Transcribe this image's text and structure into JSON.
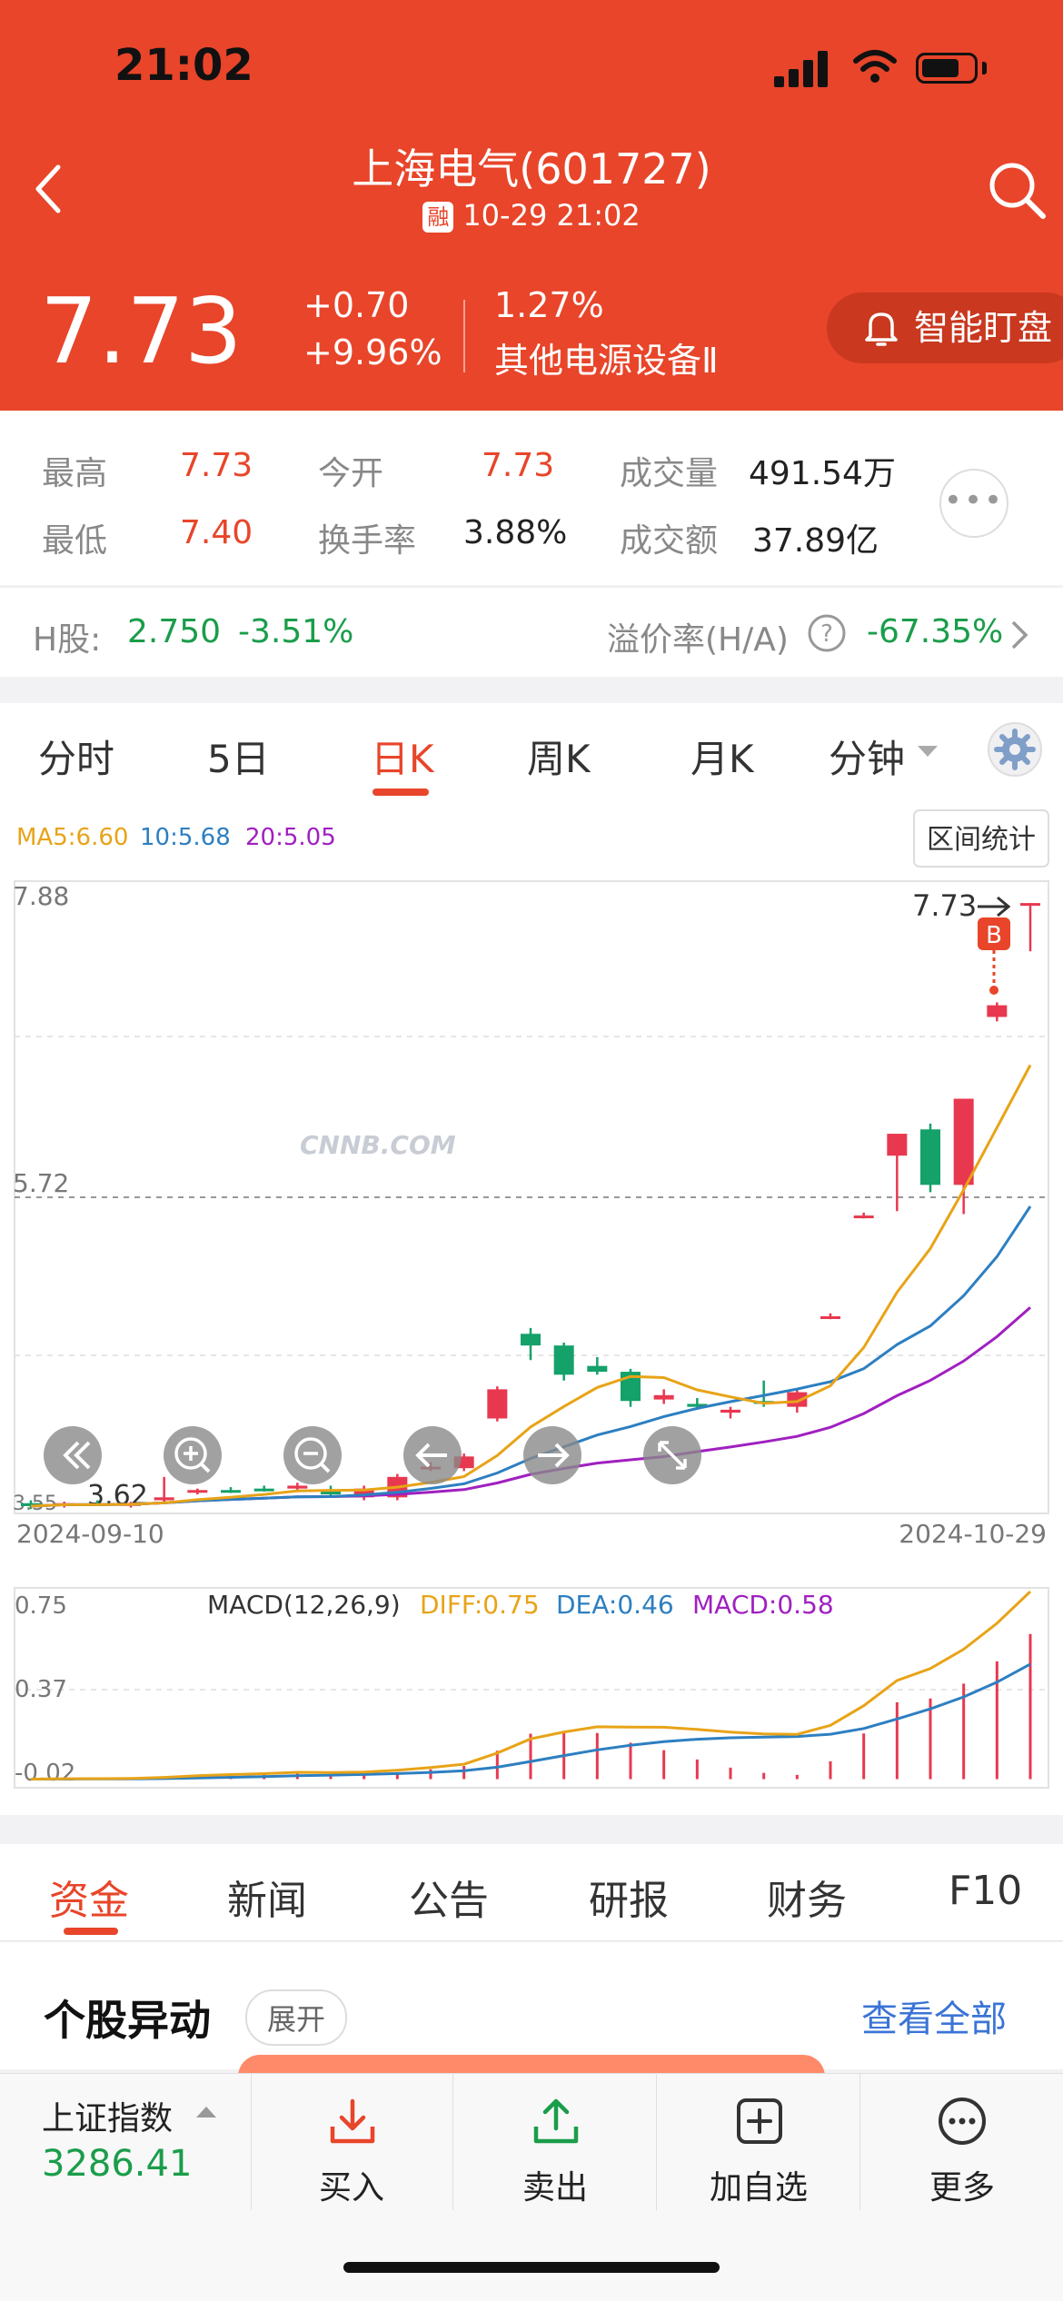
{
  "status_bar": {
    "time": "21:02"
  },
  "header": {
    "title": "上海电气(601727)",
    "rong_badge": "融",
    "datetime": "10-29 21:02",
    "price": "7.73",
    "change": "+0.70",
    "change_pct": "+9.96%",
    "industry_pct": "1.27%",
    "industry": "其他电源设备Ⅱ",
    "watch_label": "智能盯盘"
  },
  "quote": {
    "high_label": "最高",
    "high": "7.73",
    "open_label": "今开",
    "open": "7.73",
    "volume_label": "成交量",
    "volume": "491.54万",
    "low_label": "最低",
    "low": "7.40",
    "turnover_label": "换手率",
    "turnover": "3.88%",
    "amount_label": "成交额",
    "amount": "37.89亿"
  },
  "hshare": {
    "label": "H股:",
    "price": "2.750",
    "change_pct": "-3.51%",
    "premium_label": "溢价率(H/A)",
    "premium": "-67.35%"
  },
  "kline_tabs": [
    "分时",
    "5日",
    "日K",
    "周K",
    "月K",
    "分钟"
  ],
  "active_kline_tab": "日K",
  "chart": {
    "ma5": "MA5:6.60",
    "ma10": "10:5.68",
    "ma20": "20:5.05",
    "range_stats": "区间统计",
    "y_top": "7.88",
    "y_mid": "5.72",
    "y_low": "3.62",
    "y_bottom": "3.55",
    "last_price_label": "7.73",
    "buy_marker": "B",
    "x_start": "2024-09-10",
    "x_end": "2024-10-29",
    "watermark": "CNNB.COM",
    "macd_title": "MACD(12,26,9)",
    "diff": "DIFF:0.75",
    "dea": "DEA:0.46",
    "macd": "MACD:0.58",
    "macd_y_top": "0.75",
    "macd_y_mid": "0.37",
    "macd_y_bottom": "-0.02",
    "colors": {
      "ma5": "#e8a317",
      "ma10": "#2d7fc1",
      "ma20": "#a020c0",
      "up": "#e8384f",
      "down": "#14a16a"
    }
  },
  "chart_data": {
    "type": "candlestick",
    "title": "",
    "x_range": [
      "2024-09-10",
      "2024-10-29"
    ],
    "ylim": [
      3.55,
      7.88
    ],
    "candles": [
      {
        "o": 3.62,
        "h": 3.64,
        "l": 3.58,
        "c": 3.6
      },
      {
        "o": 3.61,
        "h": 3.63,
        "l": 3.59,
        "c": 3.62
      },
      {
        "o": 3.62,
        "h": 3.64,
        "l": 3.6,
        "c": 3.61
      },
      {
        "o": 3.61,
        "h": 3.63,
        "l": 3.59,
        "c": 3.62
      },
      {
        "o": 3.64,
        "h": 3.8,
        "l": 3.62,
        "c": 3.66
      },
      {
        "o": 3.7,
        "h": 3.72,
        "l": 3.68,
        "c": 3.71
      },
      {
        "o": 3.71,
        "h": 3.73,
        "l": 3.69,
        "c": 3.7
      },
      {
        "o": 3.72,
        "h": 3.74,
        "l": 3.7,
        "c": 3.71
      },
      {
        "o": 3.72,
        "h": 3.76,
        "l": 3.7,
        "c": 3.74
      },
      {
        "o": 3.7,
        "h": 3.74,
        "l": 3.66,
        "c": 3.68
      },
      {
        "o": 3.66,
        "h": 3.74,
        "l": 3.64,
        "c": 3.72
      },
      {
        "o": 3.66,
        "h": 3.82,
        "l": 3.64,
        "c": 3.8
      },
      {
        "o": 3.86,
        "h": 3.9,
        "l": 3.84,
        "c": 3.87
      },
      {
        "o": 3.86,
        "h": 3.96,
        "l": 3.84,
        "c": 3.94
      },
      {
        "o": 4.2,
        "h": 4.42,
        "l": 4.18,
        "c": 4.4
      },
      {
        "o": 4.78,
        "h": 4.82,
        "l": 4.6,
        "c": 4.7
      },
      {
        "o": 4.7,
        "h": 4.72,
        "l": 4.46,
        "c": 4.5
      },
      {
        "o": 4.56,
        "h": 4.62,
        "l": 4.5,
        "c": 4.52
      },
      {
        "o": 4.52,
        "h": 4.54,
        "l": 4.28,
        "c": 4.32
      },
      {
        "o": 4.33,
        "h": 4.4,
        "l": 4.3,
        "c": 4.36
      },
      {
        "o": 4.3,
        "h": 4.34,
        "l": 4.26,
        "c": 4.28
      },
      {
        "o": 4.24,
        "h": 4.28,
        "l": 4.2,
        "c": 4.26
      },
      {
        "o": 4.32,
        "h": 4.46,
        "l": 4.28,
        "c": 4.3
      },
      {
        "o": 4.28,
        "h": 4.4,
        "l": 4.24,
        "c": 4.38
      },
      {
        "o": 4.9,
        "h": 4.92,
        "l": 4.88,
        "c": 4.9
      },
      {
        "o": 5.59,
        "h": 5.61,
        "l": 5.57,
        "c": 5.59
      },
      {
        "o": 6.0,
        "h": 6.15,
        "l": 5.62,
        "c": 6.15
      },
      {
        "o": 6.18,
        "h": 6.22,
        "l": 5.75,
        "c": 5.8
      },
      {
        "o": 5.8,
        "h": 6.39,
        "l": 5.6,
        "c": 6.39
      },
      {
        "o": 6.95,
        "h": 7.05,
        "l": 6.92,
        "c": 7.03
      },
      {
        "o": 7.73,
        "h": 7.73,
        "l": 7.4,
        "c": 7.73
      }
    ],
    "ma5_last": 6.6,
    "ma10_last": 5.68,
    "ma20_last": 5.05,
    "macd": {
      "diff_last": 0.75,
      "dea_last": 0.46,
      "macd_last": 0.58,
      "ylim": [
        -0.02,
        0.75
      ]
    }
  },
  "bottom_tabs": [
    "资金",
    "新闻",
    "公告",
    "研报",
    "财务",
    "F10"
  ],
  "active_bottom_tab": "资金",
  "news": {
    "title": "个股异动",
    "expand": "展开",
    "view_all": "查看全部"
  },
  "bottom_bar": {
    "index_name": "上证指数",
    "index_value": "3286.41",
    "buy": "买入",
    "sell": "卖出",
    "add_watch": "加自选",
    "more": "更多"
  }
}
